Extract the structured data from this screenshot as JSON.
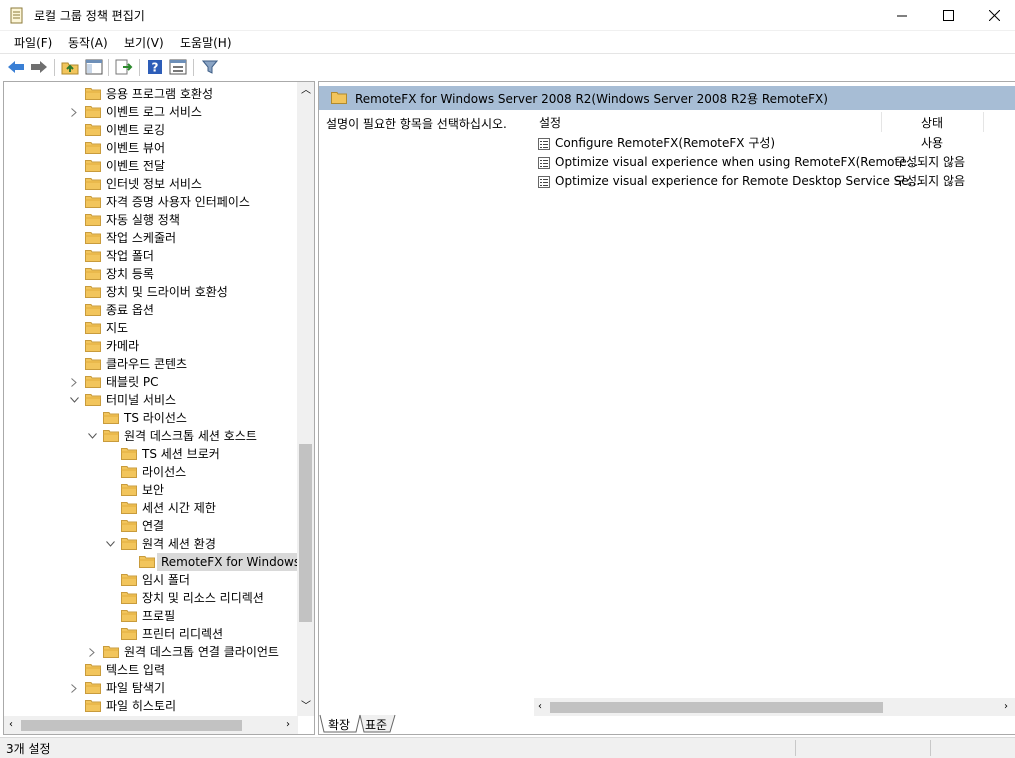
{
  "window": {
    "title": "로컬 그룹 정책 편집기"
  },
  "menu": {
    "items": [
      "파일(F)",
      "동작(A)",
      "보기(V)",
      "도움말(H)"
    ]
  },
  "toolbar": {
    "icons": [
      "back-icon",
      "forward-icon",
      "up-folder-icon",
      "show-hide-tree-icon",
      "export-list-icon",
      "help-icon",
      "properties-view-icon",
      "filter-icon"
    ]
  },
  "tree": {
    "items": [
      {
        "label": "응용 프로그램 호환성",
        "expander": ""
      },
      {
        "label": "이벤트 로그 서비스",
        "expander": ">"
      },
      {
        "label": "이벤트 로깅",
        "expander": ""
      },
      {
        "label": "이벤트 뷰어",
        "expander": ""
      },
      {
        "label": "이벤트 전달",
        "expander": ""
      },
      {
        "label": "인터넷 정보 서비스",
        "expander": ""
      },
      {
        "label": "자격 증명 사용자 인터페이스",
        "expander": ""
      },
      {
        "label": "자동 실행 정책",
        "expander": ""
      },
      {
        "label": "작업 스케줄러",
        "expander": ""
      },
      {
        "label": "작업 폴더",
        "expander": ""
      },
      {
        "label": "장치 등록",
        "expander": ""
      },
      {
        "label": "장치 및 드라이버 호환성",
        "expander": ""
      },
      {
        "label": "종료 옵션",
        "expander": ""
      },
      {
        "label": "지도",
        "expander": ""
      },
      {
        "label": "카메라",
        "expander": ""
      },
      {
        "label": "클라우드 콘텐츠",
        "expander": ""
      },
      {
        "label": "태블릿 PC",
        "expander": ">"
      },
      {
        "label": "터미널 서비스",
        "expander": "v"
      },
      {
        "label": "TS 라이선스",
        "expander": ""
      },
      {
        "label": "원격 데스크톱 세션 호스트",
        "expander": "v"
      },
      {
        "label": "TS 세션 브로커",
        "expander": ""
      },
      {
        "label": "라이선스",
        "expander": ""
      },
      {
        "label": "보안",
        "expander": ""
      },
      {
        "label": "세션 시간 제한",
        "expander": ""
      },
      {
        "label": "연결",
        "expander": ""
      },
      {
        "label": "원격 세션 환경",
        "expander": "v"
      },
      {
        "label": "RemoteFX for Windows S",
        "expander": ""
      },
      {
        "label": "임시 폴더",
        "expander": ""
      },
      {
        "label": "장치 및 리소스 리디렉션",
        "expander": ""
      },
      {
        "label": "프로필",
        "expander": ""
      },
      {
        "label": "프린터 리디렉션",
        "expander": ""
      },
      {
        "label": "원격 데스크톱 연결 클라이언트",
        "expander": ">"
      },
      {
        "label": "텍스트 입력",
        "expander": ""
      },
      {
        "label": "파일 탐색기",
        "expander": ">"
      },
      {
        "label": "파일 히스토리",
        "expander": ""
      }
    ]
  },
  "details": {
    "header": "RemoteFX for Windows Server 2008 R2(Windows Server 2008 R2용 RemoteFX)",
    "description": "설명이 필요한 항목을 선택하십시오.",
    "columns": {
      "setting": "설정",
      "state": "상태"
    },
    "rows": [
      {
        "name": "Configure RemoteFX(RemoteFX 구성)",
        "state": "사용"
      },
      {
        "name": "Optimize visual experience when using RemoteFX(Remote...",
        "state": "구성되지 않음"
      },
      {
        "name": "Optimize visual experience for Remote Desktop Service Se...",
        "state": "구성되지 않음"
      }
    ]
  },
  "tabs": [
    "확장",
    "표준"
  ],
  "status": {
    "text": "3개 설정"
  },
  "colors": {
    "header_bg": "#a7bdd5",
    "selection_bg": "#d9d9d9",
    "folder": "#f2c55c"
  }
}
